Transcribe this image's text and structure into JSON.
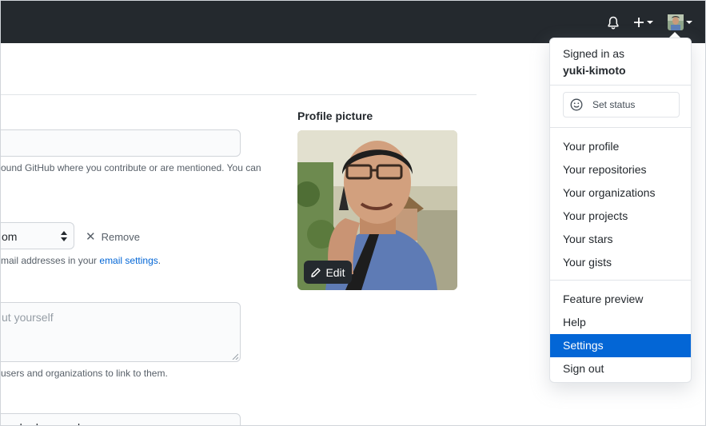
{
  "form": {
    "email_help": "ound GitHub where you contribute or are mentioned. You can",
    "email_select_value": "om",
    "remove_label": "Remove",
    "manage_note_prefix": "mail addresses in your ",
    "manage_note_link": "email settings",
    "manage_note_suffix": ".",
    "bio_placeholder": "ut yourself",
    "bio_note": "users and organizations to link to them.",
    "url_value": "nexlordsexample"
  },
  "profile_picture": {
    "title": "Profile picture",
    "edit_label": "Edit"
  },
  "user_menu": {
    "signed_in_as": "Signed in as",
    "username": "yuki-kimoto",
    "set_status": "Set status",
    "items_group1": [
      "Your profile",
      "Your repositories",
      "Your organizations",
      "Your projects",
      "Your stars",
      "Your gists"
    ],
    "items_group2": [
      "Feature preview",
      "Help",
      "Settings",
      "Sign out"
    ],
    "active_item": "Settings"
  },
  "colors": {
    "header_bg": "#24292e",
    "accent": "#0366d6"
  },
  "icons": [
    "bell-icon",
    "plus-icon",
    "avatar",
    "smiley-icon",
    "pencil-icon",
    "x-icon"
  ]
}
